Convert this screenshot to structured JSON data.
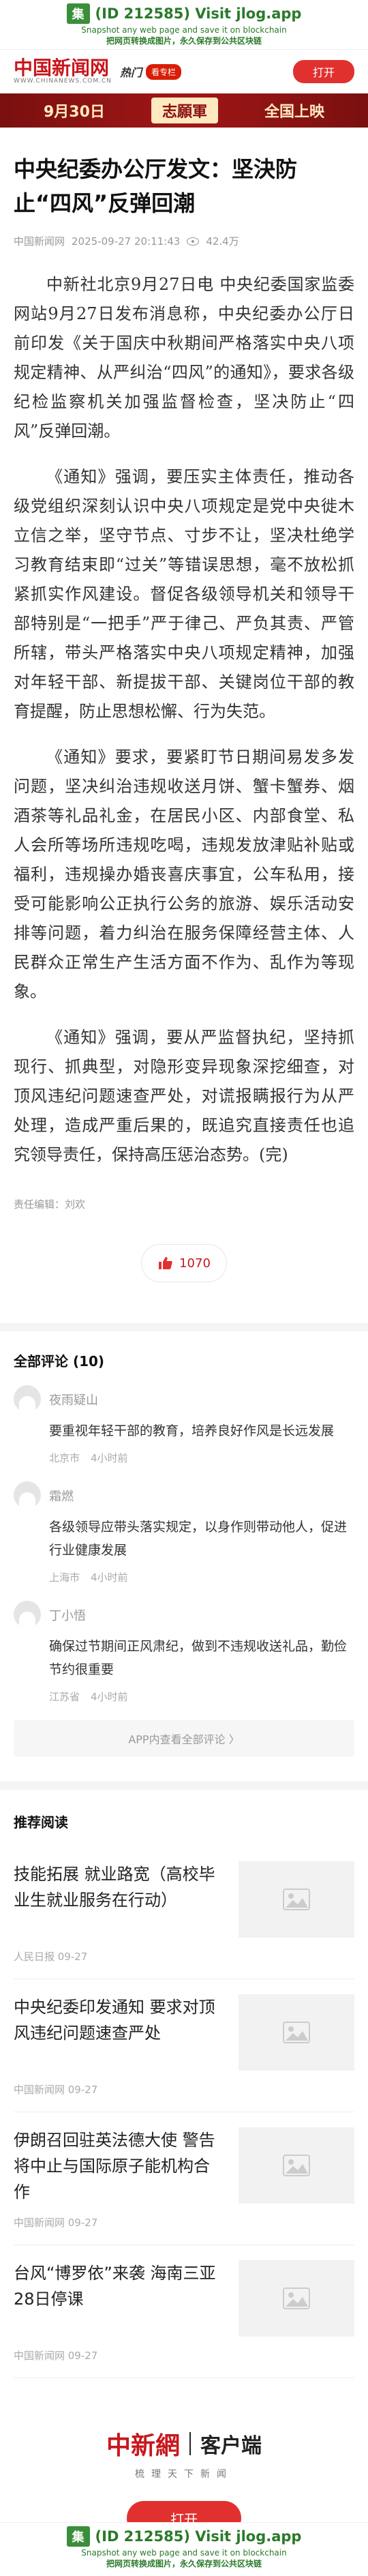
{
  "top_banner": {
    "logo_char": "集",
    "title": "(ID 212585) Visit jlog.app",
    "line1": "Snapshot any web page and save it on blockchain",
    "line2": "把网页转换成图片，永久保存到公共区块链"
  },
  "header": {
    "brand": "中国新闻网",
    "brand_url": "WWW.CHINANEWS.COM.CN",
    "tag": "热门",
    "badge": "看专栏",
    "open_label": "打开"
  },
  "ad": {
    "date": "9月30日",
    "show": "志願軍",
    "slogan": "全国上映"
  },
  "article": {
    "title": "中央纪委办公厅发文：坚決防止“四风”反弹回潮",
    "source": "中国新闻网",
    "datetime": "2025-09-27 20:11:43",
    "views": "42.4万",
    "paragraphs": [
      "中新社北京9月27日电 中央纪委国家监委网站9月27日发布消息称，中央纪委办公厅日前印发《关于国庆中秋期间严格落实中央八项规定精神、从严纠治“四风”的通知》，要求各级纪检监察机关加强监督检查，坚决防止“四风”反弹回潮。",
      "《通知》强调，要压实主体责任，推动各级党组织深刻认识中央八项规定是党中央徙木立信之举，坚守节点、寸步不让，坚决杜绝学习教育结束即“过关”等错误思想，毫不放松抓紧抓实作风建设。督促各级领导机关和领导干部特别是“一把手”严于律己、严负其责、严管所辖，带头严格落实中央八项规定精神，加强对年轻干部、新提拔干部、关键岗位干部的教育提醒，防止思想松懈、行为失范。",
      "《通知》要求，要紧盯节日期间易发多发问题，坚决纠治违规收送月饼、蟹卡蟹券、烟酒茶等礼品礼金，在居民小区、内部食堂、私人会所等场所违规吃喝，违规发放津贴补贴或福利，违规操办婚丧喜庆事宜，公车私用，接受可能影响公正执行公务的旅游、娱乐活动安排等问题，着力纠治在服务保障经营主体、人民群众正常生产生活方面不作为、乱作为等现象。",
      "《通知》强调，要从严监督执纪，坚持抓现行、抓典型，对隐形变异现象深挖细查，对顶风违纪问题速查严处，对谎报瞒报行为从严处理，造成严重后果的，既追究直接责任也追究领导责任，保持高压惩治态势。(完)"
    ],
    "editor": "责任编辑：刘欢",
    "likes": "1070"
  },
  "comments": {
    "heading": "全部评论 (10)",
    "items": [
      {
        "user": "夜雨疑山",
        "text": "要重视年轻干部的教育，培养良好作风是长远发展",
        "location": "北京市",
        "time": "4小时前"
      },
      {
        "user": "霜燃",
        "text": "各级领导应带头落实规定，以身作则带动他人，促进行业健康发展",
        "location": "上海市",
        "time": "4小时前"
      },
      {
        "user": "丁小悟",
        "text": "确保过节期间正风肃纪，做到不违规收送礼品，勤俭节约很重要",
        "location": "江苏省",
        "time": "4小时前"
      }
    ],
    "more_label": "APP内查看全部评论 〉"
  },
  "recommend": {
    "heading": "推荐阅读",
    "items": [
      {
        "title": "技能拓展 就业路宽（高校毕业生就业服务在行动）",
        "source": "人民日报 09-27"
      },
      {
        "title": "中央纪委印发通知 要求对顶风违纪问题速查严处",
        "source": "中国新闻网 09-27"
      },
      {
        "title": "伊朗召回驻英法德大使 警告将中止与国际原子能机构合作",
        "source": "中国新闻网 09-27"
      },
      {
        "title": "台风“博罗依”来袭 海南三亚28日停课",
        "source": "中国新闻网 09-27"
      }
    ]
  },
  "footer": {
    "brand": "中新網",
    "client": "客户端",
    "slogan": "梳理天下新闻",
    "open_label": "打开"
  },
  "colors": {
    "brand_red": "#c8161d",
    "button_red": "#e0312f",
    "banner_green": "#2a7a2a"
  }
}
